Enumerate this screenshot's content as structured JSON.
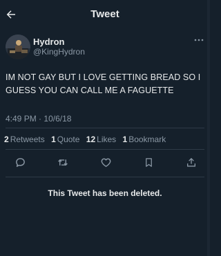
{
  "header": {
    "title": "Tweet",
    "back_icon": "arrow-left-icon"
  },
  "author": {
    "display_name": "Hydron",
    "handle": "@KingHydron",
    "more_icon": "more-horizontal-icon"
  },
  "tweet": {
    "text": "IM NOT GAY BUT I LOVE GETTING BREAD SO I GUESS YOU CAN CALL ME A FAGUETTE",
    "time": "4:49 PM",
    "date": "10/6/18"
  },
  "stats": [
    {
      "count": "2",
      "label": "Retweets"
    },
    {
      "count": "1",
      "label": "Quote"
    },
    {
      "count": "12",
      "label": "Likes"
    },
    {
      "count": "1",
      "label": "Bookmark"
    }
  ],
  "actions": [
    {
      "icon": "reply-icon"
    },
    {
      "icon": "retweet-icon"
    },
    {
      "icon": "like-icon"
    },
    {
      "icon": "bookmark-icon"
    },
    {
      "icon": "share-icon"
    }
  ],
  "notice": "This Tweet has been deleted.",
  "colors": {
    "background": "#15202b",
    "text": "#e7e9ea",
    "secondary": "#8b98a5",
    "divider": "#2f3b47"
  }
}
